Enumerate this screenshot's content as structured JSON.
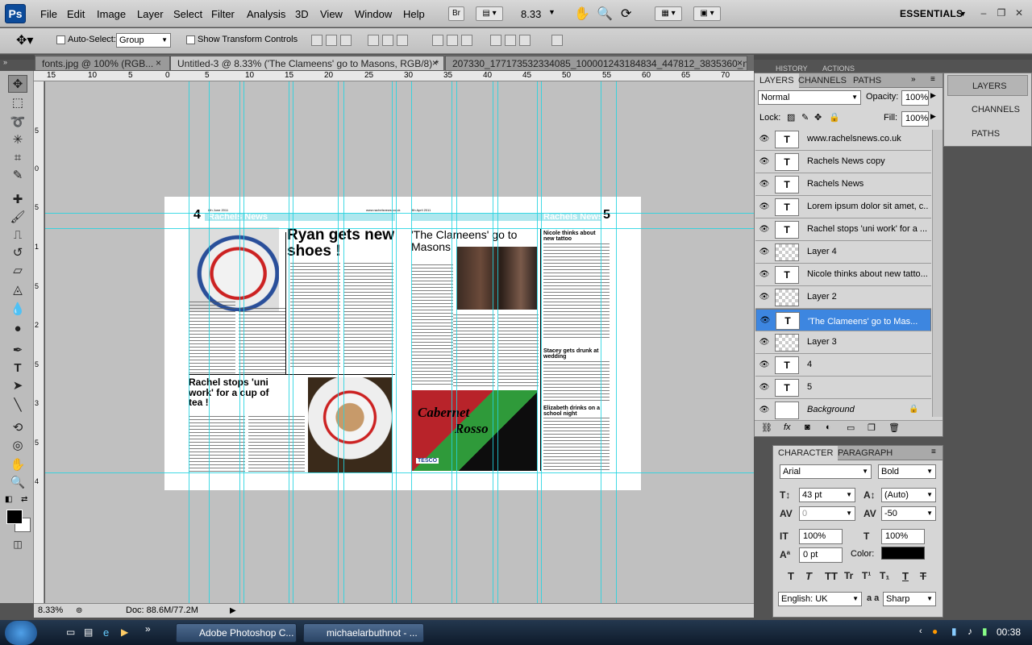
{
  "app": {
    "logo": "Ps",
    "zoom_value": "8.33",
    "workspace": "ESSENTIALS"
  },
  "menu": [
    "File",
    "Edit",
    "Image",
    "Layer",
    "Select",
    "Filter",
    "Analysis",
    "3D",
    "View",
    "Window",
    "Help"
  ],
  "menubar_buttons": {
    "bridge": "Br"
  },
  "options": {
    "auto_select_label": "Auto-Select:",
    "auto_select_value": "Group",
    "transform_label": "Show Transform Controls"
  },
  "tabs": [
    {
      "label": "fonts.jpg @ 100% (RGB...",
      "close": "×"
    },
    {
      "label": "Untitled-3 @ 8.33% ('The Clameens' go to Masons, RGB/8) *",
      "close": "×"
    },
    {
      "label": "207330_177173532334085_100001243184834_447812_3835360_n.jpg",
      "close": "×"
    }
  ],
  "ruler": {
    "h": [
      "15",
      "10",
      "5",
      "0",
      "5",
      "10",
      "15",
      "20",
      "25",
      "30",
      "35",
      "40",
      "45",
      "50",
      "55",
      "60",
      "65",
      "70"
    ],
    "v": [
      "5",
      "0",
      "5",
      "1",
      "5",
      "2",
      "5",
      "3",
      "5",
      "4"
    ]
  },
  "document": {
    "left_page_number": "4",
    "right_page_number": "5",
    "masthead": "Rachels News",
    "small_date_left": "8th June 2011",
    "small_url_left": "www.rachelsnews.co.uk",
    "small_date_right": "8th April 2011",
    "headline_shoes": "Ryan gets new shoes !",
    "headline_uniwork": "Rachel stops 'uni work' for a cup of tea !",
    "headline_clameens": "'The Clameens' go to Masons",
    "headline_tattoo": "Nicole thinks about new tattoo",
    "headline_stacey": "Stacey gets drunk at wedding",
    "headline_elizabeth": "Elizabeth drinks on a school night",
    "ad_text_1": "Cabernet",
    "ad_text_2": "Rosso",
    "ad_brand": "TESCO"
  },
  "status": {
    "zoom": "8.33%",
    "doc": "Doc: 88.6M/77.2M"
  },
  "layers_panel": {
    "tabs": [
      "LAYERS",
      "CHANNELS",
      "PATHS"
    ],
    "blend_mode": "Normal",
    "opacity_label": "Opacity:",
    "opacity_value": "100%",
    "lock_label": "Lock:",
    "fill_label": "Fill:",
    "fill_value": "100%",
    "layers": [
      {
        "name": "www.rachelsnews.co.uk",
        "type": "T"
      },
      {
        "name": "Rachels News copy",
        "type": "T"
      },
      {
        "name": "Rachels News",
        "type": "T"
      },
      {
        "name": "Lorem ipsum dolor sit amet, c...",
        "type": "T"
      },
      {
        "name": "Rachel stops 'uni work' for a ...",
        "type": "T"
      },
      {
        "name": "Layer 4",
        "type": "img"
      },
      {
        "name": "Nicole thinks about new tatto...",
        "type": "T"
      },
      {
        "name": "Layer 2",
        "type": "img"
      },
      {
        "name": "'The Clameens' go to Mas...",
        "type": "T",
        "selected": true
      },
      {
        "name": "Layer 3",
        "type": "img"
      },
      {
        "name": "4",
        "type": "T"
      },
      {
        "name": "5",
        "type": "T"
      },
      {
        "name": "Background",
        "type": "bg"
      }
    ]
  },
  "dock": [
    "LAYERS",
    "CHANNELS",
    "PATHS"
  ],
  "top_collapsed_tabs": [
    "HISTORY",
    "ACTIONS"
  ],
  "character": {
    "tabs": [
      "CHARACTER",
      "PARAGRAPH"
    ],
    "font": "Arial",
    "style": "Bold",
    "size": "43 pt",
    "leading": "(Auto)",
    "kerning": "0",
    "tracking": "-50",
    "vscale": "100%",
    "hscale": "100%",
    "baseline": "0 pt",
    "color_label": "Color:",
    "language": "English: UK",
    "aa_label": "a a",
    "antialias": "Sharp",
    "type_buttons": [
      "T",
      "T",
      "TT",
      "Tr",
      "T¹",
      "T₁",
      "T",
      "T"
    ]
  },
  "taskbar": {
    "items": [
      "Adobe Photoshop C...",
      "michaelarbuthnot - ..."
    ],
    "clock": "00:38",
    "expand": "»"
  },
  "colors": {
    "guide": "#22d4e0",
    "selected_layer": "#3d86e0",
    "masthead_band": "#aee7ee"
  }
}
